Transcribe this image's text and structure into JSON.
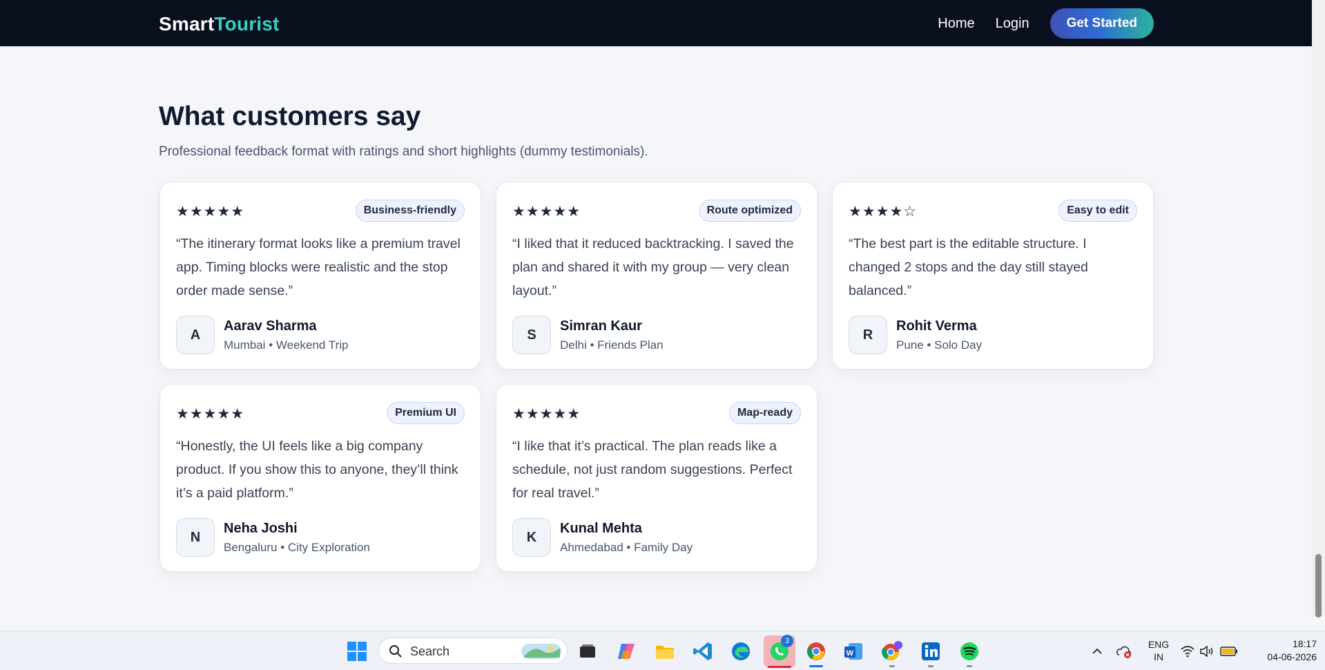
{
  "nav": {
    "brand_part1": "Smart",
    "brand_part2": "Tourist",
    "links": [
      "Home",
      "Login"
    ],
    "cta_label": "Get Started"
  },
  "section": {
    "title": "What customers say",
    "subtitle": "Professional feedback format with ratings and short highlights (dummy testimonials)."
  },
  "testimonials": [
    {
      "rating": 5,
      "stars": "★★★★★",
      "badge": "Business-friendly",
      "quote": "“The itinerary format looks like a premium travel app. Timing blocks were realistic and the stop order made sense.”",
      "initial": "A",
      "name": "Aarav Sharma",
      "meta": "Mumbai • Weekend Trip"
    },
    {
      "rating": 5,
      "stars": "★★★★★",
      "badge": "Route optimized",
      "quote": "“I liked that it reduced backtracking. I saved the plan and shared it with my group — very clean layout.”",
      "initial": "S",
      "name": "Simran Kaur",
      "meta": "Delhi • Friends Plan"
    },
    {
      "rating": 4,
      "stars": "★★★★☆",
      "badge": "Easy to edit",
      "quote": "“The best part is the editable structure. I changed 2 stops and the day still stayed balanced.”",
      "initial": "R",
      "name": "Rohit Verma",
      "meta": "Pune • Solo Day"
    },
    {
      "rating": 5,
      "stars": "★★★★★",
      "badge": "Premium UI",
      "quote": "“Honestly, the UI feels like a big company product. If you show this to anyone, they’ll think it’s a paid platform.”",
      "initial": "N",
      "name": "Neha Joshi",
      "meta": "Bengaluru • City Exploration"
    },
    {
      "rating": 5,
      "stars": "★★★★★",
      "badge": "Map-ready",
      "quote": "“I like that it’s practical. The plan reads like a schedule, not just random suggestions. Perfect for real travel.”",
      "initial": "K",
      "name": "Kunal Mehta",
      "meta": "Ahmedabad • Family Day"
    }
  ],
  "taskbar": {
    "search_placeholder": "Search",
    "whatsapp_badge": "3",
    "lang_line1": "ENG",
    "lang_line2": "IN",
    "time": "18:17",
    "date": "04-06-2026",
    "icons": [
      "windows-start-icon",
      "search-icon",
      "task-view-icon",
      "copilot-icon",
      "file-explorer-icon",
      "vscode-icon",
      "edge-icon",
      "whatsapp-icon",
      "chrome-icon",
      "word-icon",
      "chrome-profile-icon",
      "linkedin-icon",
      "spotify-icon"
    ]
  },
  "colors": {
    "nav_bg": "#0a0f1e",
    "brand_accent": "#34d3c4",
    "cta_gradient_start": "#3f51b5",
    "cta_gradient_end": "#2bb39c",
    "page_bg": "#f4f6fa",
    "badge_bg": "#eef2ff"
  }
}
